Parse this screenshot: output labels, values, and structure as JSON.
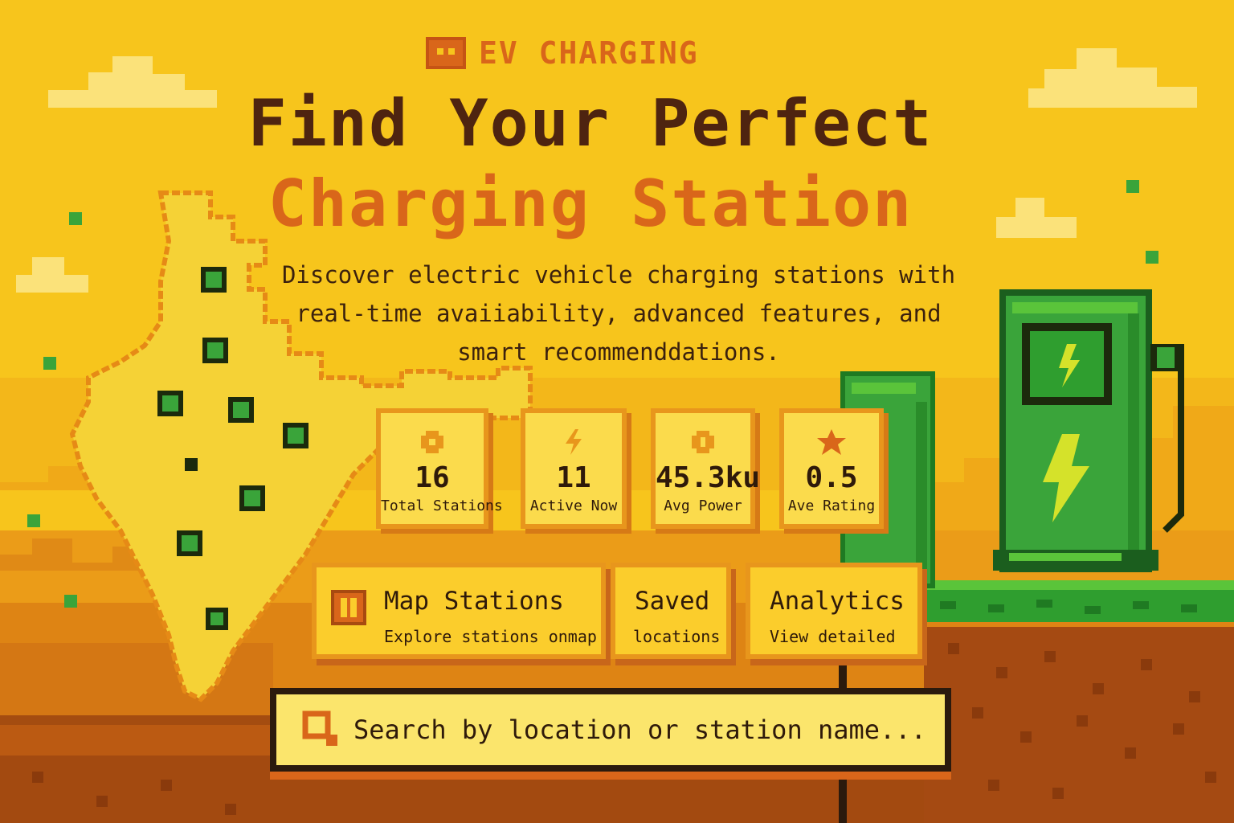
{
  "brand": {
    "name": "EV CHARGING",
    "logo_icon": "robot-head-icon"
  },
  "hero": {
    "title_line1": "Find Your Perfect",
    "title_line2": "Charging Station",
    "subtitle_lines": [
      "Discover electric vehicle charging stations with",
      "real-time avaiiability, advanced features, and",
      "smart recommenddations."
    ]
  },
  "stats": [
    {
      "icon": "gear-icon",
      "value": "16",
      "label": "Total Stations"
    },
    {
      "icon": "lightning-icon",
      "value": "11",
      "label": "Active Now"
    },
    {
      "icon": "power-icon",
      "value": "45.3ku",
      "label": "Avg Power"
    },
    {
      "icon": "star-icon",
      "value": "0.5",
      "label": "Ave Rating"
    }
  ],
  "features": [
    {
      "icon": "map-icon",
      "title": "Map Stations",
      "desc": "Explore stations onmap"
    },
    {
      "title": "Saved",
      "desc": "locations"
    },
    {
      "title": "Analytics",
      "desc": "View detailed"
    }
  ],
  "search": {
    "placeholder": "Search by location or station name...",
    "icon": "search-icon"
  },
  "colors": {
    "background": "#f7c51c",
    "title_dark": "#4e2410",
    "accent_orange": "#d9661a",
    "card_border": "#e8961c",
    "charger_green": "#3aa43a",
    "marker_green": "#2f9e2f"
  }
}
